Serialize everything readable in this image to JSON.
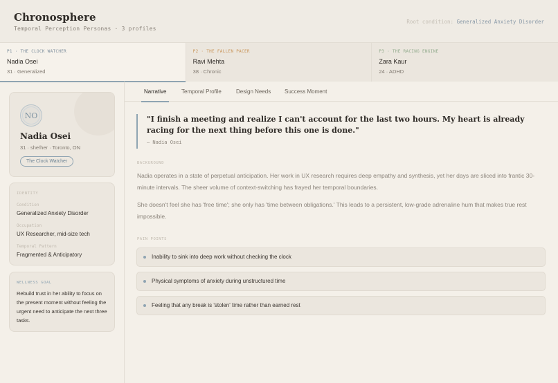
{
  "header": {
    "title": "Chronosphere",
    "subtitle": "Temporal Perception Personas · 3 profiles",
    "root_label": "Root condition:",
    "root_value": "Generalized Anxiety Disorder"
  },
  "personas": [
    {
      "code": "P1 · THE CLOCK WATCHER",
      "name": "Nadia Osei",
      "meta": "31 · Generalized"
    },
    {
      "code": "P2 · THE FALLEN PACER",
      "name": "Ravi Mehta",
      "meta": "38 · Chronic"
    },
    {
      "code": "P3 · THE RACING ENGINE",
      "name": "Zara Kaur",
      "meta": "24 · ADHD"
    }
  ],
  "profile": {
    "initials": "NO",
    "name": "Nadia Osei",
    "meta": "31 · she/her · Toronto, ON",
    "archetype": "The Clock Watcher"
  },
  "identity": {
    "label": "IDENTITY",
    "fields": [
      {
        "label": "Condition",
        "value": "Generalized Anxiety Disorder"
      },
      {
        "label": "Occupation",
        "value": "UX Researcher, mid-size tech"
      },
      {
        "label": "Temporal Pattern",
        "value": "Fragmented & Anticipatory"
      }
    ]
  },
  "wellness": {
    "label": "WELLNESS GOAL",
    "text": "Rebuild trust in her ability to focus on the present moment without feeling the urgent need to anticipate the next three tasks."
  },
  "tabs": [
    "Narrative",
    "Temporal Profile",
    "Design Needs",
    "Success Moment"
  ],
  "narrative": {
    "quote": "\"I finish a meeting and realize I can't account for the last two hours. My heart is already racing for the next thing before this one is done.\"",
    "attribution": "— Nadia Osei",
    "background_label": "BACKGROUND",
    "paragraphs": [
      "Nadia operates in a state of perpetual anticipation. Her work in UX research requires deep empathy and synthesis, yet her days are sliced into frantic 30-minute intervals. The sheer volume of context-switching has frayed her temporal boundaries.",
      "She doesn't feel she has 'free time'; she only has 'time between obligations.' This leads to a persistent, low-grade adrenaline hum that makes true rest impossible."
    ],
    "pain_label": "PAIN POINTS",
    "pain_points": [
      "Inability to sink into deep work without checking the clock",
      "Physical symptoms of anxiety during unstructured time",
      "Feeling that any break is 'stolen' time rather than earned rest"
    ]
  },
  "colors": {
    "accent": "#8fa4b2",
    "p2_accent": "#c9955a",
    "p3_accent": "#8fa98a",
    "background": "#f4f0e9"
  }
}
